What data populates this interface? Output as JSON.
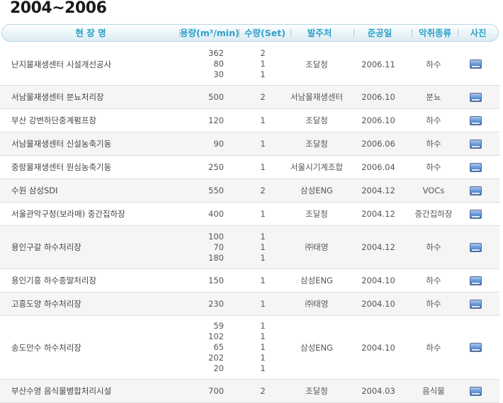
{
  "page": {
    "title": "2004~2006"
  },
  "header": {
    "name": "현 장 명",
    "capacity": "용량(m³/min)",
    "quantity": "수량(Set)",
    "client": "발주처",
    "date": "준공일",
    "type": "악취종류",
    "photo": "사진"
  },
  "rows": [
    {
      "name": "난지물재생센터 시설개선공사",
      "capacity": [
        "362",
        "80",
        "30"
      ],
      "quantity": [
        "2",
        "1",
        "1"
      ],
      "client": "조달청",
      "date": "2006.11",
      "type": "하수"
    },
    {
      "name": "서남물재생센터 분뇨처리장",
      "capacity": [
        "500"
      ],
      "quantity": [
        "2"
      ],
      "client": "서남물재생센터",
      "date": "2006.10",
      "type": "분뇨"
    },
    {
      "name": "부산 강변하단중계펌프장",
      "capacity": [
        "120"
      ],
      "quantity": [
        "1"
      ],
      "client": "조달청",
      "date": "2006.10",
      "type": "하수"
    },
    {
      "name": "서남물재생센터 신설농축기동",
      "capacity": [
        "90"
      ],
      "quantity": [
        "1"
      ],
      "client": "조달청",
      "date": "2006.06",
      "type": "하수"
    },
    {
      "name": "중랑물재생센터 원심농축기동",
      "capacity": [
        "250"
      ],
      "quantity": [
        "1"
      ],
      "client": "서울시기계조합",
      "date": "2006.04",
      "type": "하수"
    },
    {
      "name": "수원 삼성SDI",
      "capacity": [
        "550"
      ],
      "quantity": [
        "2"
      ],
      "client": "삼성ENG",
      "date": "2004.12",
      "type": "VOCs"
    },
    {
      "name": "서울관악구청(보라매) 중간집하장",
      "capacity": [
        "400"
      ],
      "quantity": [
        "1"
      ],
      "client": "조달청",
      "date": "2004.12",
      "type": "중간집하장"
    },
    {
      "name": "용인구갈 하수처리장",
      "capacity": [
        "100",
        "70",
        "180"
      ],
      "quantity": [
        "1",
        "1",
        "1"
      ],
      "client": "㈜태영",
      "date": "2004.12",
      "type": "하수"
    },
    {
      "name": "용인기흥 하수종말처리장",
      "capacity": [
        "150"
      ],
      "quantity": [
        "1"
      ],
      "client": "삼성ENG",
      "date": "2004.10",
      "type": "하수"
    },
    {
      "name": "고흥도양 하수처리장",
      "capacity": [
        "230"
      ],
      "quantity": [
        "1"
      ],
      "client": "㈜태영",
      "date": "2004.10",
      "type": "하수"
    },
    {
      "name": "송도만수 하수처리장",
      "capacity": [
        "59",
        "102",
        "65",
        "202",
        "20"
      ],
      "quantity": [
        "1",
        "1",
        "1",
        "1",
        "1"
      ],
      "client": "삼성ENG",
      "date": "2004.10",
      "type": "하수"
    },
    {
      "name": "부산수영 음식물병합처리시설",
      "capacity": [
        "700"
      ],
      "quantity": [
        "2"
      ],
      "client": "조달청",
      "date": "2004.03",
      "type": "음식물"
    }
  ]
}
